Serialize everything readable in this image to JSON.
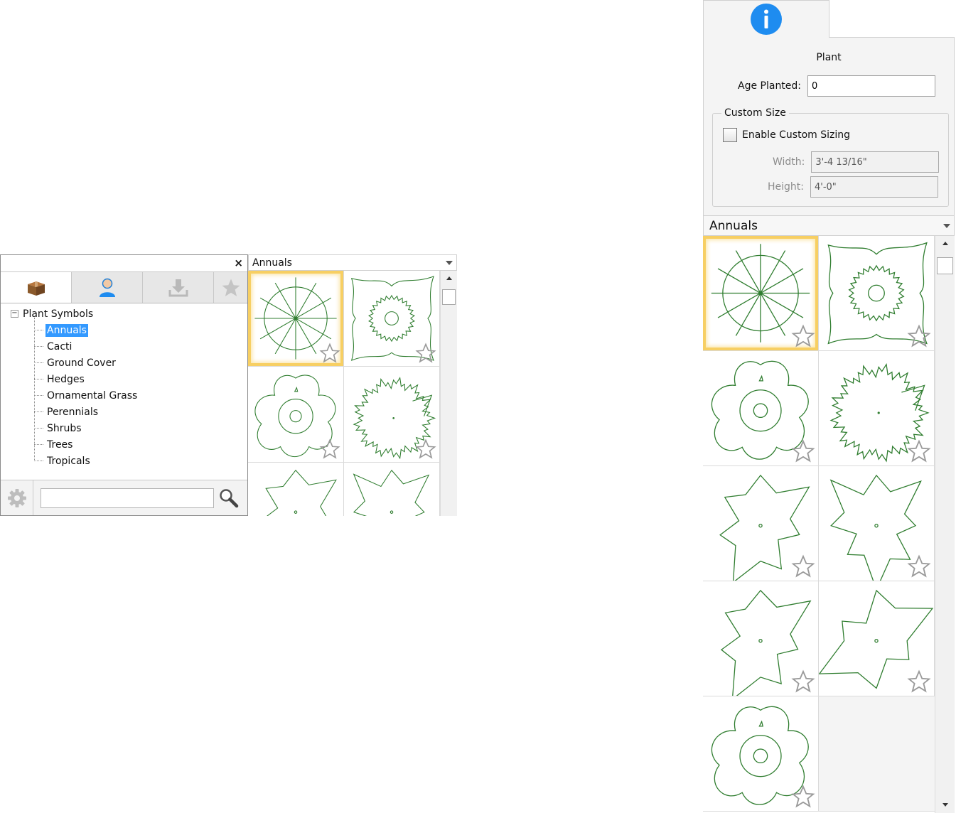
{
  "library": {
    "close_glyph": "×",
    "tabs": [
      {
        "id": "tab-library",
        "icon": "box-icon"
      },
      {
        "id": "tab-user",
        "icon": "user-icon"
      },
      {
        "id": "tab-downloads",
        "icon": "download-icon"
      },
      {
        "id": "tab-favorites",
        "icon": "star-icon"
      }
    ],
    "tree": {
      "root_label": "Plant Symbols",
      "expander": "−",
      "items": [
        "Annuals",
        "Cacti",
        "Ground Cover",
        "Hedges",
        "Ornamental Grass",
        "Perennials",
        "Shrubs",
        "Trees",
        "Tropicals"
      ],
      "selected": "Annuals"
    },
    "search": {
      "value": "",
      "placeholder": ""
    }
  },
  "symbol_grid": {
    "category": "Annuals",
    "symbols": [
      "annual-1",
      "annual-2",
      "annual-3",
      "annual-4",
      "annual-5",
      "annual-6",
      "annual-7",
      "annual-8",
      "annual-9"
    ]
  },
  "properties": {
    "info_icon": "info-icon",
    "title": "Plant",
    "age_planted_label": "Age Planted:",
    "age_planted_value": "0",
    "custom_size_legend": "Custom Size",
    "enable_label": "Enable Custom Sizing",
    "width_label": "Width:",
    "width_value": "3'-4 13/16\"",
    "height_label": "Height:",
    "height_value": "4'-0\""
  },
  "colors": {
    "plant_stroke": "#2f7d2f",
    "selection": "#f7cf63",
    "tree_selected": "#3399ff",
    "info_blue": "#1e8cf0"
  }
}
